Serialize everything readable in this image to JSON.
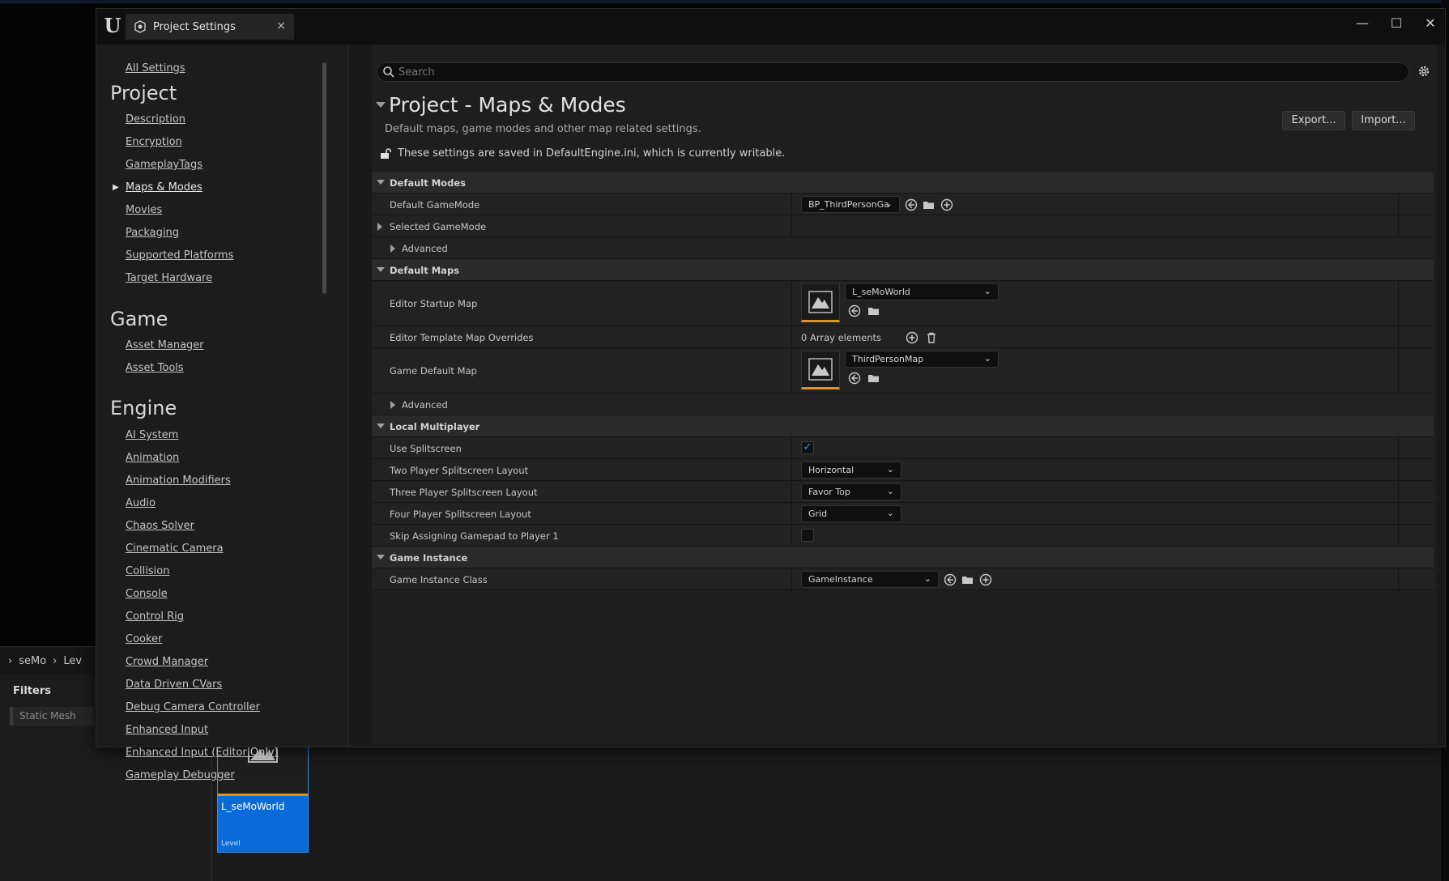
{
  "background": {
    "breadcrumb": [
      "seMo",
      "Lev"
    ],
    "filters_title": "Filters",
    "filter_item": "Static Mesh",
    "asset": {
      "name": "L_seMoWorld",
      "type": "Level"
    }
  },
  "window": {
    "tab_title": "Project Settings",
    "tab_close": "×",
    "controls": {
      "minimize": "—",
      "maximize": "☐",
      "close": "✕"
    }
  },
  "sidebar": {
    "all_settings": "All Settings",
    "sections": [
      {
        "heading": "Project",
        "items": [
          "Description",
          "Encryption",
          "GameplayTags",
          "Maps & Modes",
          "Movies",
          "Packaging",
          "Supported Platforms",
          "Target Hardware"
        ]
      },
      {
        "heading": "Game",
        "items": [
          "Asset Manager",
          "Asset Tools"
        ]
      },
      {
        "heading": "Engine",
        "items": [
          "AI System",
          "Animation",
          "Animation Modifiers",
          "Audio",
          "Chaos Solver",
          "Cinematic Camera",
          "Collision",
          "Console",
          "Control Rig",
          "Cooker",
          "Crowd Manager",
          "Data Driven CVars",
          "Debug Camera Controller",
          "Enhanced Input",
          "Enhanced Input (Editor Only)",
          "Gameplay Debugger"
        ]
      }
    ],
    "selected": "Maps & Modes"
  },
  "main": {
    "search_placeholder": "Search",
    "title": "Project - Maps & Modes",
    "description": "Default maps, game modes and other map related settings.",
    "export_label": "Export...",
    "import_label": "Import...",
    "writable_notice": "These settings are saved in DefaultEngine.ini, which is currently writable."
  },
  "settings": {
    "default_modes": {
      "category": "Default Modes",
      "default_gamemode_label": "Default GameMode",
      "default_gamemode_value": "BP_ThirdPersonGa",
      "selected_gamemode_label": "Selected GameMode",
      "advanced_label": "Advanced"
    },
    "default_maps": {
      "category": "Default Maps",
      "editor_startup_label": "Editor Startup Map",
      "editor_startup_value": "L_seMoWorld",
      "template_overrides_label": "Editor Template Map Overrides",
      "template_overrides_value": "0 Array elements",
      "game_default_label": "Game Default Map",
      "game_default_value": "ThirdPersonMap",
      "advanced_label": "Advanced"
    },
    "local_multiplayer": {
      "category": "Local Multiplayer",
      "use_splitscreen_label": "Use Splitscreen",
      "use_splitscreen": true,
      "two_player_label": "Two Player Splitscreen Layout",
      "two_player_value": "Horizontal",
      "three_player_label": "Three Player Splitscreen Layout",
      "three_player_value": "Favor Top",
      "four_player_label": "Four Player Splitscreen Layout",
      "four_player_value": "Grid",
      "skip_gamepad_label": "Skip Assigning Gamepad to Player 1",
      "skip_gamepad": false
    },
    "game_instance": {
      "category": "Game Instance",
      "class_label": "Game Instance Class",
      "class_value": "GameInstance"
    }
  },
  "colors": {
    "accent_blue": "#0a6bd8",
    "thumb_underline": "#e0901e",
    "check_blue": "#3c8cf0"
  }
}
